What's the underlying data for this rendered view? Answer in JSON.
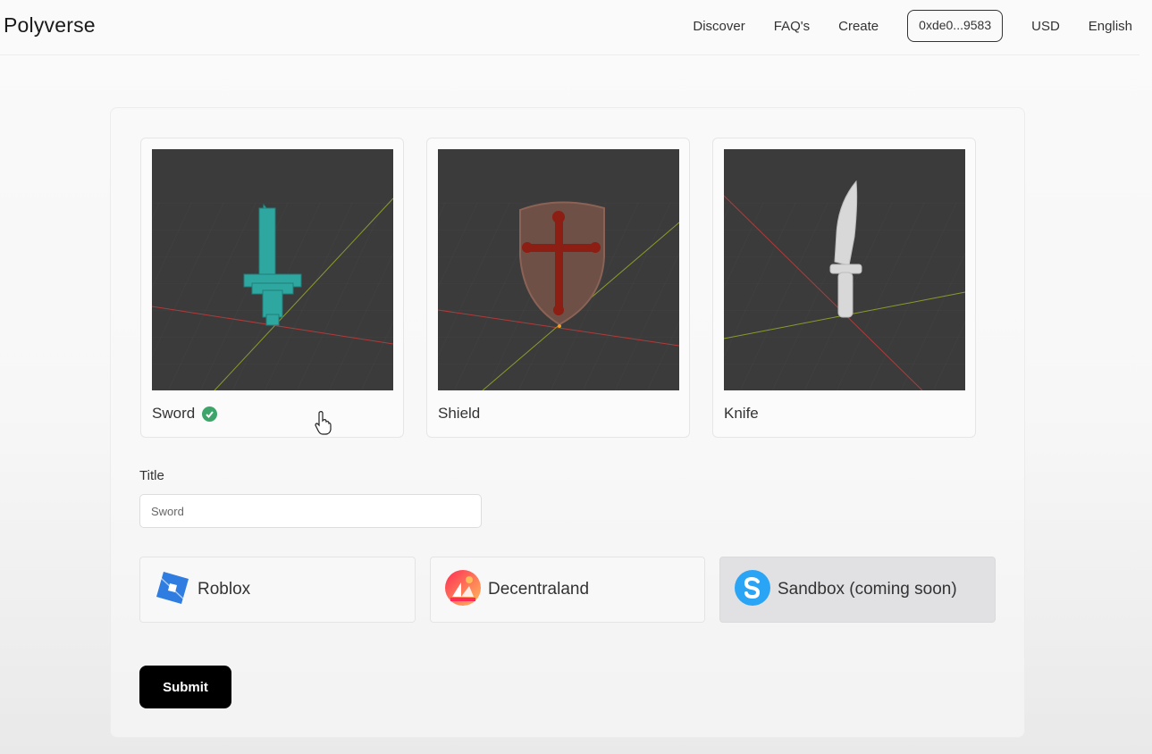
{
  "header": {
    "brand": "Polyverse",
    "nav": [
      "Discover",
      "FAQ's",
      "Create"
    ],
    "wallet": "0xde0...9583",
    "currency": "USD",
    "language": "English"
  },
  "items": [
    {
      "name": "Sword",
      "selected": true,
      "icon": "check-circle-icon",
      "color": "#2ea7a0"
    },
    {
      "name": "Shield",
      "selected": false,
      "color": "#8c1e14"
    },
    {
      "name": "Knife",
      "selected": false,
      "color": "#d8d8d8"
    }
  ],
  "form": {
    "title_label": "Title",
    "title_value": "Sword"
  },
  "platforms": [
    {
      "label": "Roblox",
      "icon": "roblox-icon",
      "disabled": false
    },
    {
      "label": "Decentraland",
      "icon": "decentraland-icon",
      "disabled": false
    },
    {
      "label": "Sandbox (coming soon)",
      "icon": "sandbox-icon",
      "disabled": true
    }
  ],
  "submit_label": "Submit",
  "colors": {
    "accent_check": "#3da46a",
    "submit_bg": "#000000",
    "viewport_bg": "#3b3b3b",
    "disabled_bg": "#e1e1e3"
  }
}
